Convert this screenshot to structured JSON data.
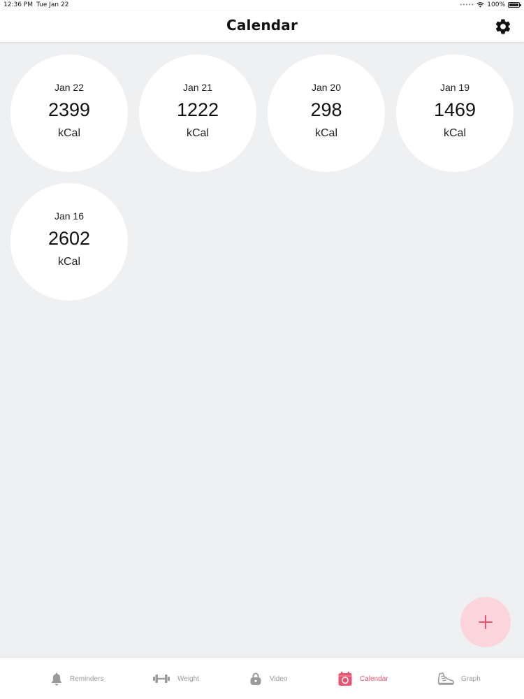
{
  "status_bar": {
    "time": "12:36 PM",
    "date": "Tue Jan 22",
    "battery": "100%"
  },
  "header": {
    "title": "Calendar",
    "settings_icon": "gear-icon"
  },
  "days": [
    {
      "date": "Jan 22",
      "value": "2399",
      "unit": "kCal"
    },
    {
      "date": "Jan 21",
      "value": "1222",
      "unit": "kCal"
    },
    {
      "date": "Jan 20",
      "value": "298",
      "unit": "kCal"
    },
    {
      "date": "Jan 19",
      "value": "1469",
      "unit": "kCal"
    },
    {
      "date": "Jan 16",
      "value": "2602",
      "unit": "kCal"
    }
  ],
  "fab": {
    "icon": "plus-icon",
    "color": "#fcd4dc",
    "icon_color": "#e8546f"
  },
  "tabs": [
    {
      "label": "Reminders",
      "icon": "bell-icon",
      "active": false
    },
    {
      "label": "Weight",
      "icon": "dumbbell-icon",
      "active": false
    },
    {
      "label": "Video",
      "icon": "lock-icon",
      "active": false
    },
    {
      "label": "Calendar",
      "icon": "calendar-icon",
      "active": true
    },
    {
      "label": "Graph",
      "icon": "shoe-icon",
      "active": false
    }
  ],
  "colors": {
    "accent": "#e8546f",
    "inactive": "#9a9a9a",
    "background": "#eff0f2"
  }
}
